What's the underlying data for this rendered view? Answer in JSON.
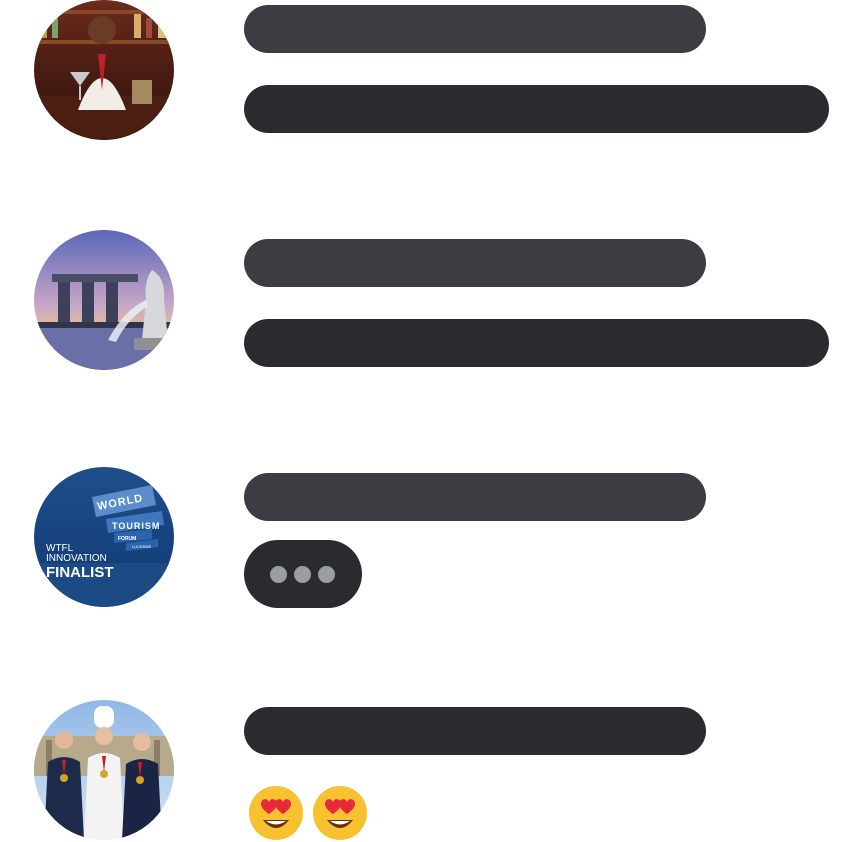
{
  "messages": [
    {
      "avatar_icon": "bartender-photo-avatar",
      "content": "placeholder-bars"
    },
    {
      "avatar_icon": "singapore-skyline-avatar",
      "content": "placeholder-bars"
    },
    {
      "avatar_icon": "wtfl-logo-avatar",
      "avatar_text": {
        "line1": "WORLD",
        "line2": "TOURISM",
        "line3": "FORUM",
        "line4": "LUCERNE",
        "line5": "WTFL",
        "line6": "INNOVATION",
        "line7": "FINALIST"
      },
      "content": "typing-indicator"
    },
    {
      "avatar_icon": "chefs-team-photo-avatar",
      "content": "emoji-reactions",
      "emojis": [
        "heart-eyes-emoji",
        "heart-eyes-emoji"
      ]
    }
  ],
  "colors": {
    "bar_light": "#3b3d42",
    "bar_dark": "#2a2b2f",
    "typing_dot": "#9a9da3",
    "emoji_face": "#f7c12f",
    "emoji_heart": "#e8283c"
  }
}
